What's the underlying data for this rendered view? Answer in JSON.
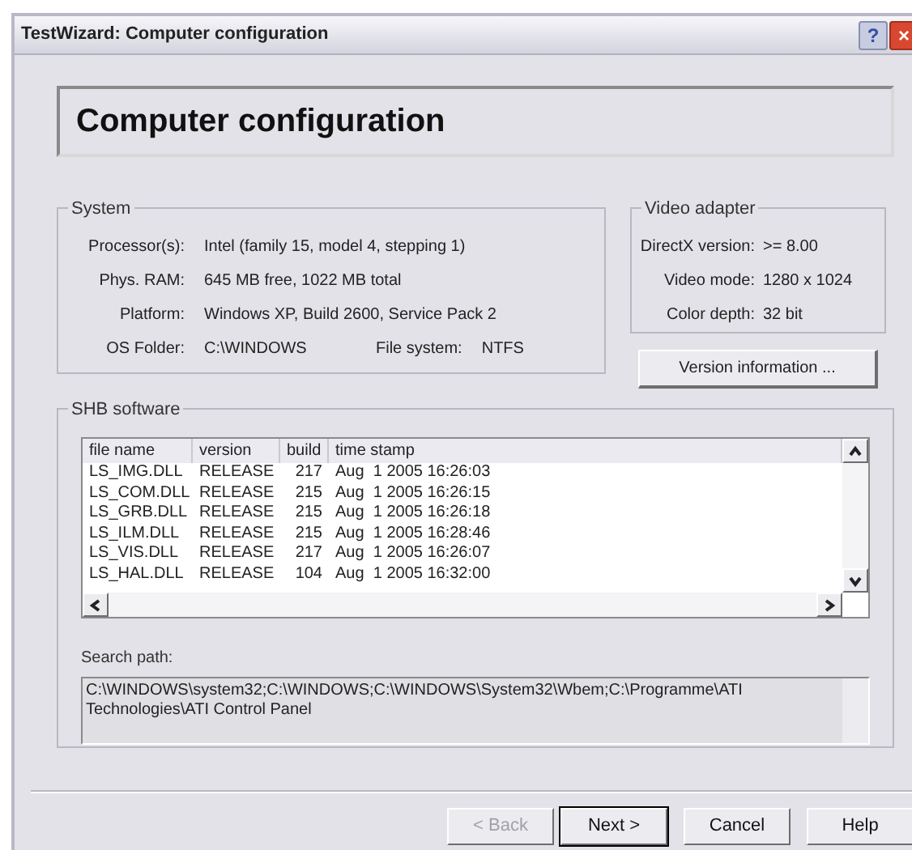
{
  "window": {
    "title": "TestWizard: Computer configuration",
    "title_buttons": [
      "?",
      "×"
    ]
  },
  "header": {
    "title": "Computer configuration"
  },
  "system": {
    "legend": "System",
    "rows": [
      {
        "label": "Processor(s):",
        "value": "Intel (family 15, model 4, stepping 1)"
      },
      {
        "label": "Phys. RAM:",
        "value": "645 MB free, 1022 MB total"
      },
      {
        "label": "Platform:",
        "value": "Windows XP, Build 2600, Service Pack 2"
      },
      {
        "label": "OS Folder:",
        "value": "C:\\WINDOWS",
        "extra_label": "File system:",
        "extra_value": "NTFS"
      }
    ]
  },
  "video_adapter": {
    "legend": "Video adapter",
    "rows": [
      {
        "label": "DirectX version:",
        "value": ">= 8.00"
      },
      {
        "label": "Video mode:",
        "value": "1280 x 1024"
      },
      {
        "label": "Color depth:",
        "value": "32 bit"
      }
    ],
    "button": "Version information ..."
  },
  "shb_software": {
    "legend": "SHB software",
    "table": {
      "columns": [
        "file name",
        "version",
        "build",
        "time stamp"
      ],
      "rows": [
        [
          "LS_IMG.DLL",
          "RELEASE",
          "217",
          "Aug  1 2005 16:26:03"
        ],
        [
          "LS_COM.DLL",
          "RELEASE",
          "215",
          "Aug  1 2005 16:26:15"
        ],
        [
          "LS_GRB.DLL",
          "RELEASE",
          "215",
          "Aug  1 2005 16:26:18"
        ],
        [
          "LS_ILM.DLL",
          "RELEASE",
          "215",
          "Aug  1 2005 16:28:46"
        ],
        [
          "LS_VIS.DLL",
          "RELEASE",
          "217",
          "Aug  1 2005 16:26:07"
        ],
        [
          "LS_HAL.DLL",
          "RELEASE",
          "104",
          "Aug  1 2005 16:32:00"
        ]
      ]
    },
    "search_path_label": "Search path:",
    "search_path": "C:\\WINDOWS\\system32;C:\\WINDOWS;C:\\WINDOWS\\System32\\Wbem;C:\\Programme\\ATI Technologies\\ATI Control Panel"
  },
  "buttons": [
    {
      "label": "< Back",
      "disabled": true,
      "default": false
    },
    {
      "label": "Next >",
      "disabled": false,
      "default": true
    },
    {
      "label": "Cancel",
      "disabled": false,
      "default": false
    },
    {
      "label": "Help",
      "disabled": false,
      "default": false
    }
  ]
}
